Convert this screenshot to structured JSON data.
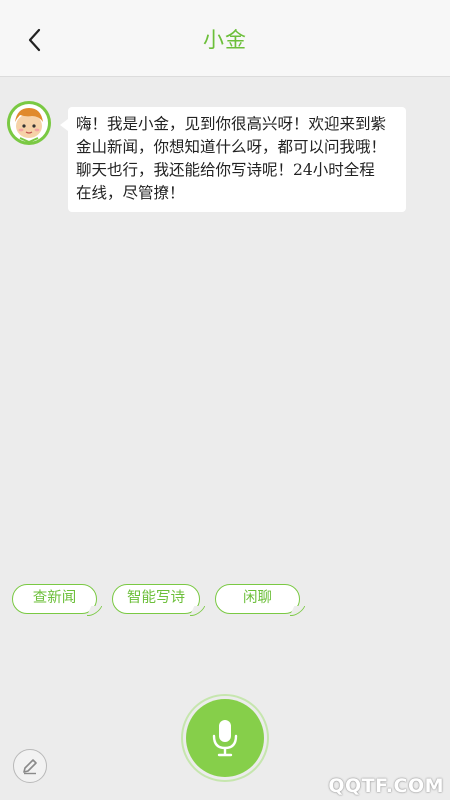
{
  "header": {
    "title": "小金",
    "back_icon": "chevron-left-icon"
  },
  "chat": {
    "bot_avatar": "bot-avatar",
    "messages": [
      {
        "sender": "bot",
        "lines": [
          "嗨！我是小金，见到你很高兴呀！欢迎来到紫",
          "金山新闻，你想知道什么呀，都可以问我哦！",
          "聊天也行，我还能给你写诗呢！24小时全程",
          "在线，尽管撩！"
        ]
      }
    ]
  },
  "quick_replies": [
    "查新闻",
    "智能写诗",
    "闲聊"
  ],
  "bottom": {
    "mic_icon": "microphone-icon",
    "edit_icon": "pencil-icon"
  },
  "watermark": "QQTF.COM",
  "colors": {
    "accent": "#6cbf3a",
    "mic": "#86cf4a",
    "background": "#ececec"
  }
}
